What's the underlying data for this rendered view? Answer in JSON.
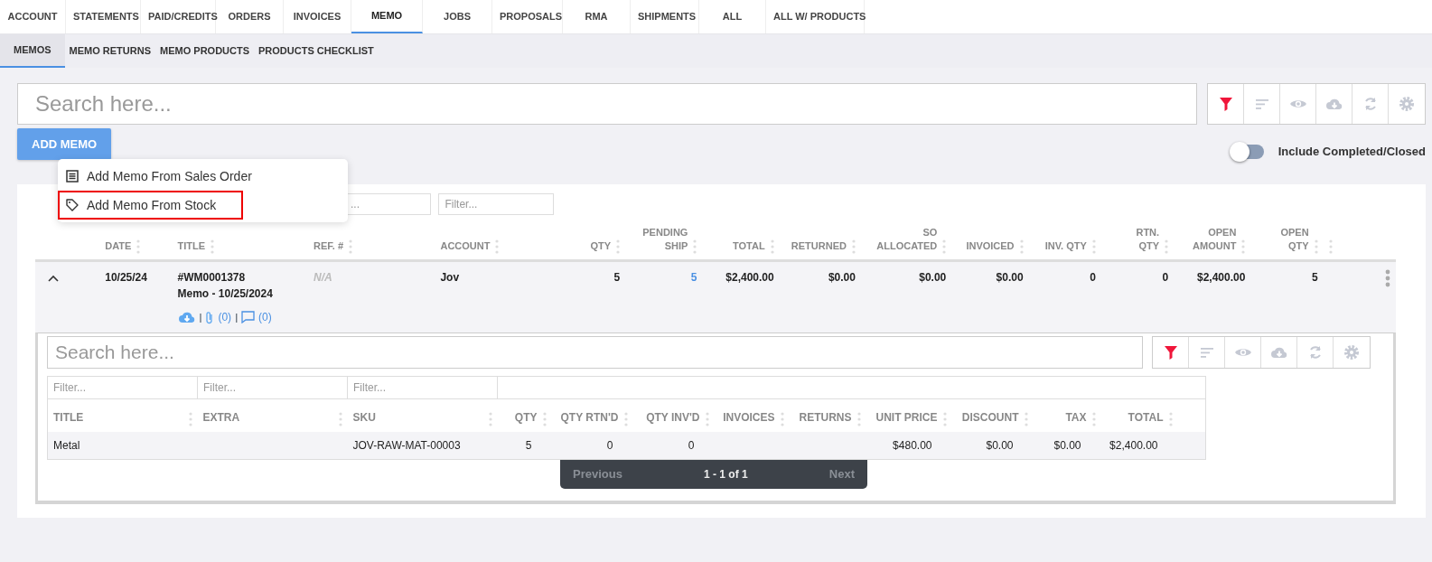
{
  "top_tabs": [
    {
      "label": "ACCOUNT",
      "selected": false
    },
    {
      "label": "STATEMENTS",
      "selected": false
    },
    {
      "label": "PAID/CREDITS",
      "selected": false
    },
    {
      "label": "ORDERS",
      "selected": false
    },
    {
      "label": "INVOICES",
      "selected": false
    },
    {
      "label": "MEMO",
      "selected": true
    },
    {
      "label": "JOBS",
      "selected": false
    },
    {
      "label": "PROPOSALS",
      "selected": false
    },
    {
      "label": "RMA",
      "selected": false
    },
    {
      "label": "SHIPMENTS",
      "selected": false
    },
    {
      "label": "ALL",
      "selected": false
    },
    {
      "label": "ALL W/ PRODUCTS",
      "selected": false
    }
  ],
  "sub_tabs": [
    {
      "label": "MEMOS",
      "selected": true
    },
    {
      "label": "MEMO RETURNS",
      "selected": false
    },
    {
      "label": "MEMO PRODUCTS",
      "selected": false
    },
    {
      "label": "PRODUCTS CHECKLIST",
      "selected": false
    }
  ],
  "search": {
    "placeholder": "Search here..."
  },
  "add_button": "ADD MEMO",
  "add_menu": [
    {
      "kind": "list",
      "label": "Add Memo From Sales Order",
      "highlighted": false
    },
    {
      "kind": "tag",
      "label": "Add Memo From Stock",
      "highlighted": true
    }
  ],
  "toggle": {
    "label": "Include Completed/Closed",
    "on": false
  },
  "memos": {
    "filters": [
      {
        "placeholder": "..."
      },
      {
        "placeholder": "Filter..."
      }
    ],
    "columns": [
      {
        "kind": "blank"
      },
      {
        "kind": "text",
        "lines": [
          "DATE"
        ]
      },
      {
        "kind": "text",
        "lines": [
          "TITLE"
        ]
      },
      {
        "kind": "text",
        "lines": [
          "REF. #"
        ]
      },
      {
        "kind": "text",
        "lines": [
          "ACCOUNT"
        ]
      },
      {
        "kind": "num",
        "lines": [
          "QTY"
        ]
      },
      {
        "kind": "num",
        "lines": [
          "PENDING",
          "SHIP"
        ]
      },
      {
        "kind": "num",
        "lines": [
          "TOTAL"
        ]
      },
      {
        "kind": "num",
        "lines": [
          "RETURNED"
        ]
      },
      {
        "kind": "num",
        "lines": [
          "SO",
          "ALLOCATED"
        ]
      },
      {
        "kind": "num",
        "lines": [
          "INVOICED"
        ]
      },
      {
        "kind": "num",
        "lines": [
          "INV. QTY"
        ]
      },
      {
        "kind": "num",
        "lines": [
          "RTN.",
          "QTY"
        ]
      },
      {
        "kind": "num",
        "lines": [
          "OPEN",
          "AMOUNT"
        ]
      },
      {
        "kind": "num",
        "lines": [
          "OPEN",
          "QTY"
        ]
      },
      {
        "kind": "blank"
      }
    ],
    "rows": [
      {
        "expanded": true,
        "date": "10/25/24",
        "title": [
          "#WM0001378",
          "Memo - 10/25/2024"
        ],
        "attachments": "(0)",
        "comments": "(0)",
        "dividers": [
          "|",
          "|"
        ],
        "ref": "N/A",
        "account": "Jov",
        "qty": "5",
        "pending_ship": "5",
        "total": "$2,400.00",
        "returned": "$0.00",
        "so_allocated": "$0.00",
        "invoiced": "$0.00",
        "inv_qty": "0",
        "rtn_qty": "0",
        "open_amount": "$2,400.00",
        "open_qty": "5"
      }
    ]
  },
  "detail": {
    "search": {
      "placeholder": "Search here..."
    },
    "filters": [
      {
        "placeholder": "Filter..."
      },
      {
        "placeholder": "Filter..."
      },
      {
        "placeholder": "Filter..."
      }
    ],
    "columns": [
      {
        "kind": "text",
        "label": "TITLE"
      },
      {
        "kind": "text",
        "label": "EXTRA"
      },
      {
        "kind": "text",
        "label": "SKU"
      },
      {
        "kind": "num",
        "label": "QTY"
      },
      {
        "kind": "num",
        "label": "QTY RTN'D"
      },
      {
        "kind": "num",
        "label": "QTY INV'D"
      },
      {
        "kind": "num",
        "label": "INVOICES"
      },
      {
        "kind": "num",
        "label": "RETURNS"
      },
      {
        "kind": "num",
        "label": "UNIT PRICE"
      },
      {
        "kind": "num",
        "label": "DISCOUNT"
      },
      {
        "kind": "num",
        "label": "TAX"
      },
      {
        "kind": "num",
        "label": "TOTAL"
      }
    ],
    "rows": [
      [
        "Metal",
        "",
        "JOV-RAW-MAT-00003",
        "5",
        "0",
        "0",
        "",
        "",
        "$480.00",
        "$0.00",
        "$0.00",
        "$2,400.00"
      ]
    ],
    "pagination": {
      "previous": "Previous",
      "range": "1 - 1 of 1",
      "next": "Next"
    }
  }
}
